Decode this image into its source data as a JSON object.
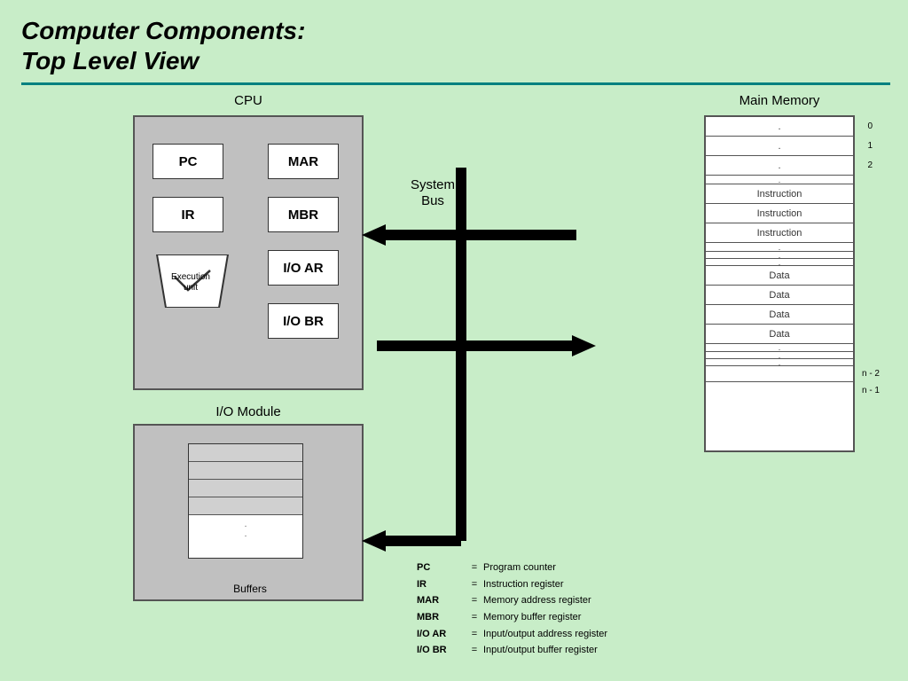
{
  "title": {
    "line1": "Computer Components:",
    "line2": "Top Level View"
  },
  "cpu": {
    "label": "CPU",
    "registers": {
      "pc": "PC",
      "mar": "MAR",
      "ir": "IR",
      "mbr": "MBR",
      "ioar": "I/O AR",
      "iobr": "I/O BR"
    },
    "execution_unit": "Execution\nunit"
  },
  "memory": {
    "label": "Main Memory",
    "rows": [
      {
        "content": ".",
        "addr": "0"
      },
      {
        "content": ".",
        "addr": "1"
      },
      {
        "content": ".",
        "addr": "2"
      },
      {
        "content": "",
        "addr": ""
      },
      {
        "content": "Instruction",
        "addr": ""
      },
      {
        "content": "Instruction",
        "addr": ""
      },
      {
        "content": "Instruction",
        "addr": ""
      },
      {
        "content": ".",
        "addr": ""
      },
      {
        "content": ".",
        "addr": ""
      },
      {
        "content": ".",
        "addr": ""
      },
      {
        "content": "Data",
        "addr": ""
      },
      {
        "content": "Data",
        "addr": ""
      },
      {
        "content": "Data",
        "addr": ""
      },
      {
        "content": "Data",
        "addr": ""
      },
      {
        "content": ".",
        "addr": ""
      },
      {
        "content": ".",
        "addr": ""
      },
      {
        "content": ".",
        "addr": ""
      },
      {
        "content": "",
        "addr": "n - 2"
      },
      {
        "content": "",
        "addr": "n - 1"
      }
    ]
  },
  "io_module": {
    "label": "I/O Module",
    "buffers_label": "Buffers"
  },
  "bus": {
    "label": "System\nBus"
  },
  "legend": [
    {
      "key": "PC",
      "eq": "=",
      "val": "Program counter"
    },
    {
      "key": "IR",
      "eq": "=",
      "val": "Instruction register"
    },
    {
      "key": "MAR",
      "eq": "=",
      "val": "Memory address register"
    },
    {
      "key": "MBR",
      "eq": "=",
      "val": "Memory buffer register"
    },
    {
      "key": "I/O AR",
      "eq": "=",
      "val": "Input/output address register"
    },
    {
      "key": "I/O BR",
      "eq": "=",
      "val": "Input/output buffer register"
    }
  ]
}
